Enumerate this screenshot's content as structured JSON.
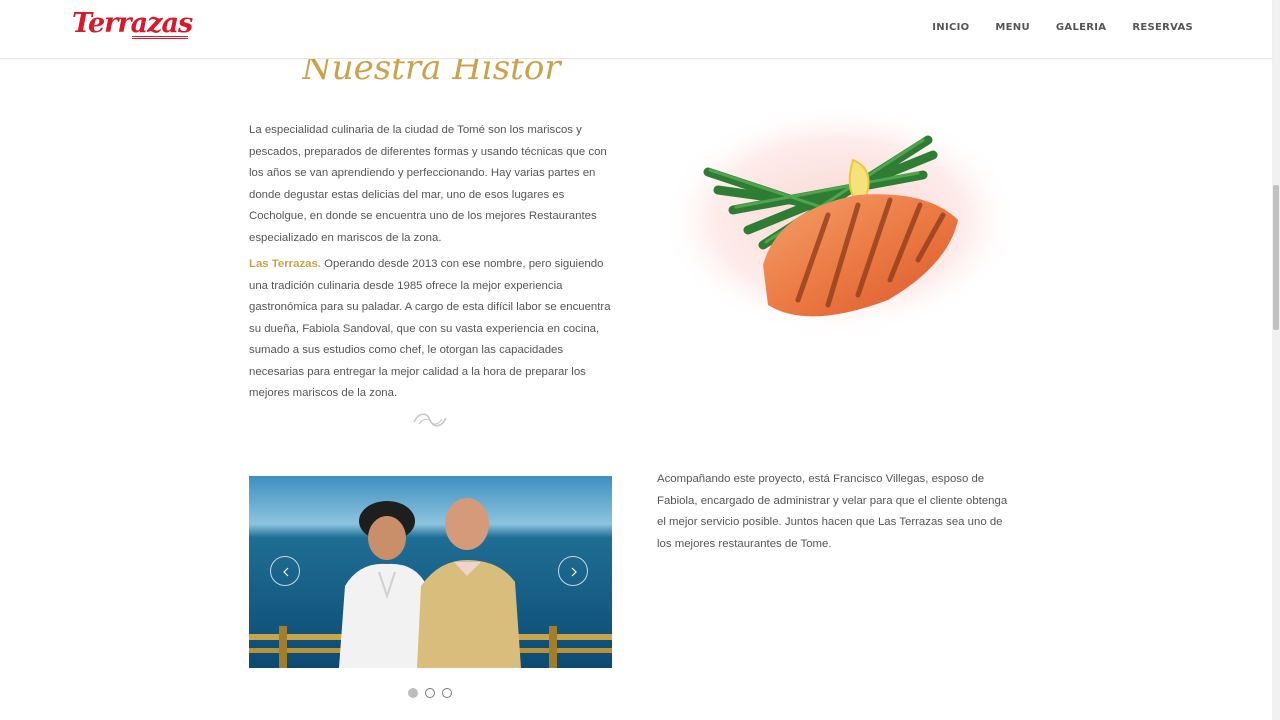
{
  "header": {
    "logo_text": "Terrazas",
    "nav": [
      "INICIO",
      "MENU",
      "GALERIA",
      "RESERVAS"
    ]
  },
  "section": {
    "title": "Nuestra Historia",
    "paragraph1": "La especialidad culinaria de la ciudad de Tomé son los mariscos y pescados, preparados de diferentes formas y usando técnicas que con los años se van aprendiendo y perfeccionando. Hay varias partes en donde degustar estas delicias del mar, uno de esos lugares es Cocholgue, en donde se encuentra uno de los mejores Restaurantes especializado en mariscos de la zona.",
    "paragraph2_highlight": "Las Terrazas.",
    "paragraph2_rest": " Operando desde 2013 con ese nombre, pero siguiendo una tradición culinaria desde 1985 ofrece la mejor experiencia gastronómica para su paladar. A cargo de esta difícil labor se encuentra su dueña, Fabiola Sandoval, que con su vasta experiencia en cocina, sumado a sus estudios como chef, le otorgan las capacidades necesarias para entregar la mejor calidad a la hora de preparar los mejores mariscos de la zona.",
    "paragraph3": "Acompañando este proyecto, está Francisco Villegas, esposo de Fabiola, encargado de administrar y velar para que el cliente obtenga el mejor servicio posible. Juntos hacen que Las Terrazas sea uno de los mejores restaurantes de Tome."
  },
  "carousel": {
    "slide_count": 3,
    "active_index": 0
  },
  "colors": {
    "brand_red": "#d8192b",
    "accent_gold": "#c9a24b",
    "text": "#555555"
  }
}
